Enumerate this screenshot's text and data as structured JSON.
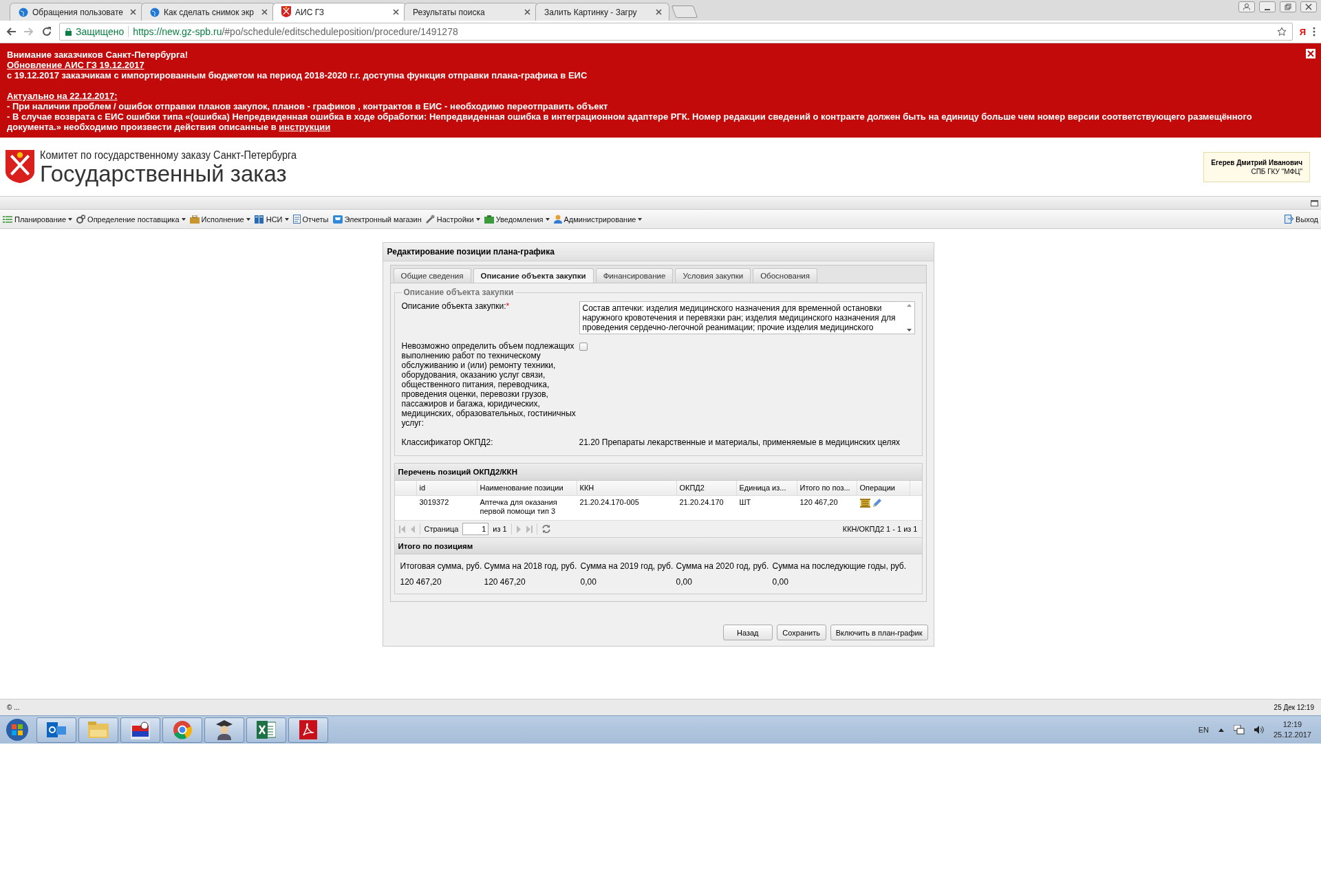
{
  "browser": {
    "tabs": [
      {
        "title": "Обращения пользовате",
        "selected": false
      },
      {
        "title": "Как сделать снимок экр",
        "selected": false
      },
      {
        "title": "АИС ГЗ",
        "selected": true
      },
      {
        "title": "Результаты поиска",
        "selected": false
      },
      {
        "title": "Залить Картинку - Загру",
        "selected": false
      }
    ],
    "security_label": "Защищено",
    "url_host": "https://new.gz-spb.ru",
    "url_path": "/#po/schedule/editscheduleposition/procedure/1491278",
    "extension_label": "Я"
  },
  "banner": {
    "sections": [
      {
        "lines": [
          {
            "kind": "text",
            "text": "Внимание заказчиков Санкт-Петербурга!"
          },
          {
            "kind": "heading",
            "text": "Обновление АИС ГЗ 19.12.2017"
          },
          {
            "kind": "text",
            "text": "с 19.12.2017 заказчикам с импортированным бюджетом на период 2018-2020 г.г.  доступна функция отправки плана-графика  в ЕИС"
          }
        ]
      },
      {
        "lines": [
          {
            "kind": "heading",
            "text": "Актуально на 22.12.2017:"
          },
          {
            "kind": "text",
            "text": "- При наличии проблем / ошибок отправки планов закупок, планов - графиков , контрактов в ЕИС - необходимо переотправить объект"
          },
          {
            "kind": "text",
            "text": "- В случае возврата с ЕИС ошибки типа «(ошибка) Непредвиденная ошибка в ходе обработки: Непредвиденная ошибка в интеграционном адаптере РГК. Номер редакции сведений о контракте должен быть на единицу больше чем номер версии соответствующего размещённого документа.» необходимо произвести действия  описанные в ",
            "link": "инструкции"
          }
        ]
      }
    ]
  },
  "header": {
    "organization": "Комитет по государственному заказу Санкт-Петербурга",
    "app_title": "Государственный заказ",
    "user_name": "Егерев Дмитрий Иванович",
    "user_org": "СПБ ГКУ \"МФЦ\""
  },
  "menu": {
    "items": [
      {
        "label": "Планирование",
        "dropdown": true
      },
      {
        "label": "Определение поставщика",
        "dropdown": true
      },
      {
        "label": "Исполнение",
        "dropdown": true
      },
      {
        "label": "НСИ",
        "dropdown": true
      },
      {
        "label": "Отчеты",
        "dropdown": false
      },
      {
        "label": "Электронный магазин",
        "dropdown": false
      },
      {
        "label": "Настройки",
        "dropdown": true
      },
      {
        "label": "Уведомления",
        "dropdown": true
      },
      {
        "label": "Администрирование",
        "dropdown": true
      }
    ],
    "exit": "Выход"
  },
  "dialog": {
    "title": "Редактирование позиции плана-графика",
    "tabs": [
      {
        "label": "Общие сведения",
        "selected": false
      },
      {
        "label": "Описание объекта закупки",
        "selected": true
      },
      {
        "label": "Финансирование",
        "selected": false
      },
      {
        "label": "Условия закупки",
        "selected": false
      },
      {
        "label": "Обоснования",
        "selected": false
      }
    ],
    "fieldset": {
      "legend": "Описание объекта закупки",
      "description": {
        "label": "Описание объекта закупки:",
        "required_mark": "*",
        "value": "Состав аптечки: изделия медицинского назначения для временной остановки наружного кровотечения и перевязки ран; изделия медицинского назначения для проведения сердечно-легочной реанимации; прочие изделия медицинского"
      },
      "checkbox": {
        "label": "Невозможно определить объем подлежащих выполнению работ по техническому обслуживанию и (или) ремонту техники, оборудования, оказанию услуг связи, общественного питания, переводчика, проведения оценки, перевозки грузов, пассажиров и багажа, юридических, медицинских, образовательных, гостиничных услуг:",
        "checked": false
      },
      "classifier": {
        "label": "Классификатор ОКПД2:",
        "value": "21.20 Препараты лекарственные и материалы, применяемые в медицинских целях"
      }
    },
    "grid": {
      "title": "Перечень позиций ОКПД2/ККН",
      "columns": [
        "id",
        "Наименование позиции",
        "ККН",
        "ОКПД2",
        "Единица из...",
        "Итого по поз...",
        "Операции"
      ],
      "rows": [
        {
          "cells": [
            "3019372",
            "Аптечка для оказания первой помощи тип 3",
            "21.20.24.170-005",
            "21.20.24.170",
            "ШТ",
            "120 467,20"
          ]
        }
      ],
      "pager": {
        "page_label": "Страница",
        "page": "1",
        "of_label": "из 1",
        "summary": "ККН/ОКПД2 1 - 1 из 1"
      }
    },
    "totals": {
      "title": "Итого по позициям",
      "items": [
        {
          "label": "Итоговая сумма, руб.",
          "value": "120 467,20"
        },
        {
          "label": "Сумма на 2018 год, руб.",
          "value": "120 467,20"
        },
        {
          "label": "Сумма на 2019 год, руб.",
          "value": "0,00"
        },
        {
          "label": "Сумма на 2020 год, руб.",
          "value": "0,00"
        },
        {
          "label": "Сумма на последующие годы, руб.",
          "value": "0,00"
        }
      ]
    },
    "buttons": [
      "Назад",
      "Сохранить",
      "Включить в план-график"
    ]
  },
  "status_bar": {
    "left": "© ...",
    "right": "25 Дек 12:19"
  },
  "taskbar": {
    "language": "EN",
    "time": "12:19",
    "date": "25.12.2017"
  }
}
